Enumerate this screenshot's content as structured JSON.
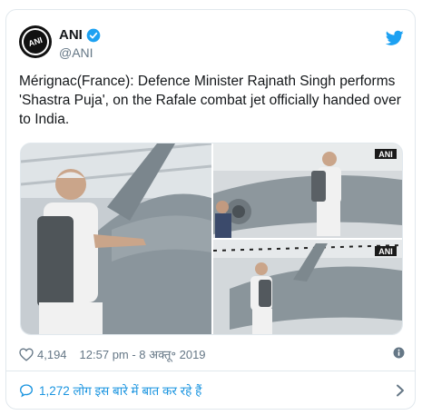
{
  "account": {
    "name": "ANI",
    "handle": "@ANI",
    "avatar_text": "ANI",
    "avatar_icon": "ani-logo-avatar",
    "verified_icon": "verified-badge-icon"
  },
  "tweet": {
    "text": "Mérignac(France): Defence Minister Rajnath Singh performs 'Shastra Puja', on the Rafale combat jet officially handed over to India."
  },
  "media": {
    "watermark": "ANI"
  },
  "meta": {
    "likes": "4,194",
    "timestamp": "12:57 pm - 8 अक्तू॰ 2019"
  },
  "conversation": {
    "label": "1,272 लोग इस बारे में बात कर रहे हैं"
  },
  "colors": {
    "accent": "#1b95e0",
    "text": "#14171a",
    "muted": "#657786",
    "border": "#e1e8ed"
  }
}
